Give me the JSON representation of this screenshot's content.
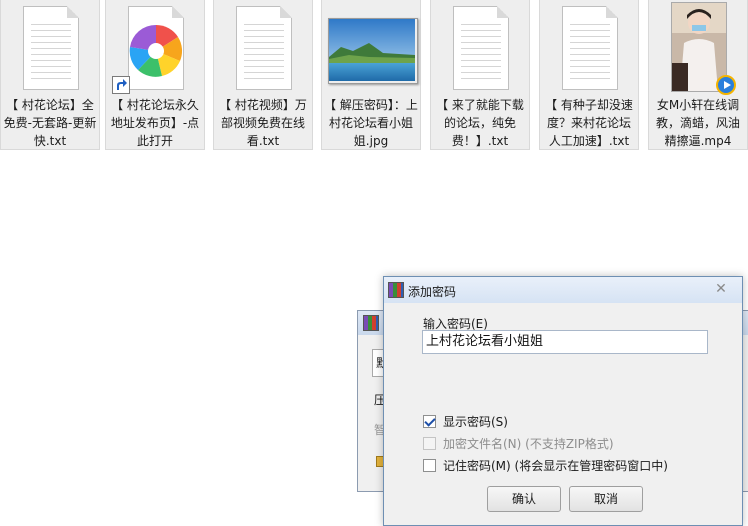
{
  "files": [
    {
      "name": "【 村花论坛】全免费-无套路-更新快.txt",
      "type": "text-document"
    },
    {
      "name": "【 村花论坛永久地址发布页】-点此打开",
      "type": "shortcut"
    },
    {
      "name": "【 村花视频】万部视频免费在线看.txt",
      "type": "text-document"
    },
    {
      "name": "【 解压密码】：上村花论坛看小姐姐.jpg",
      "type": "image"
    },
    {
      "name": "【 来了就能下载的论坛，纯免费！】.txt",
      "type": "text-document"
    },
    {
      "name": "【 有种子却没速度？来村花论坛人工加速】.txt",
      "type": "text-document"
    },
    {
      "name": "女M小轩在线调教，滴蜡，风油精擦逼.mp4",
      "type": "video"
    }
  ],
  "background_window": {
    "fragments": [
      "默",
      "压",
      "智"
    ]
  },
  "dialog": {
    "title": "添加密码",
    "password_label": "输入密码(E)",
    "password_value": "上村花论坛看小姐姐",
    "options": [
      {
        "label": "显示密码(S)",
        "checked": true,
        "enabled": true
      },
      {
        "label": "加密文件名(N) (不支持ZIP格式)",
        "checked": false,
        "enabled": false
      },
      {
        "label": "记住密码(M) (将会显示在管理密码窗口中)",
        "checked": false,
        "enabled": true
      }
    ],
    "ok_label": "确认",
    "cancel_label": "取消",
    "close_glyph": "✕"
  },
  "colors": {
    "dialog_border": "#6e8fb3",
    "checkmark": "#1d4fa8",
    "file_tile_bg": "#eeeeee"
  }
}
